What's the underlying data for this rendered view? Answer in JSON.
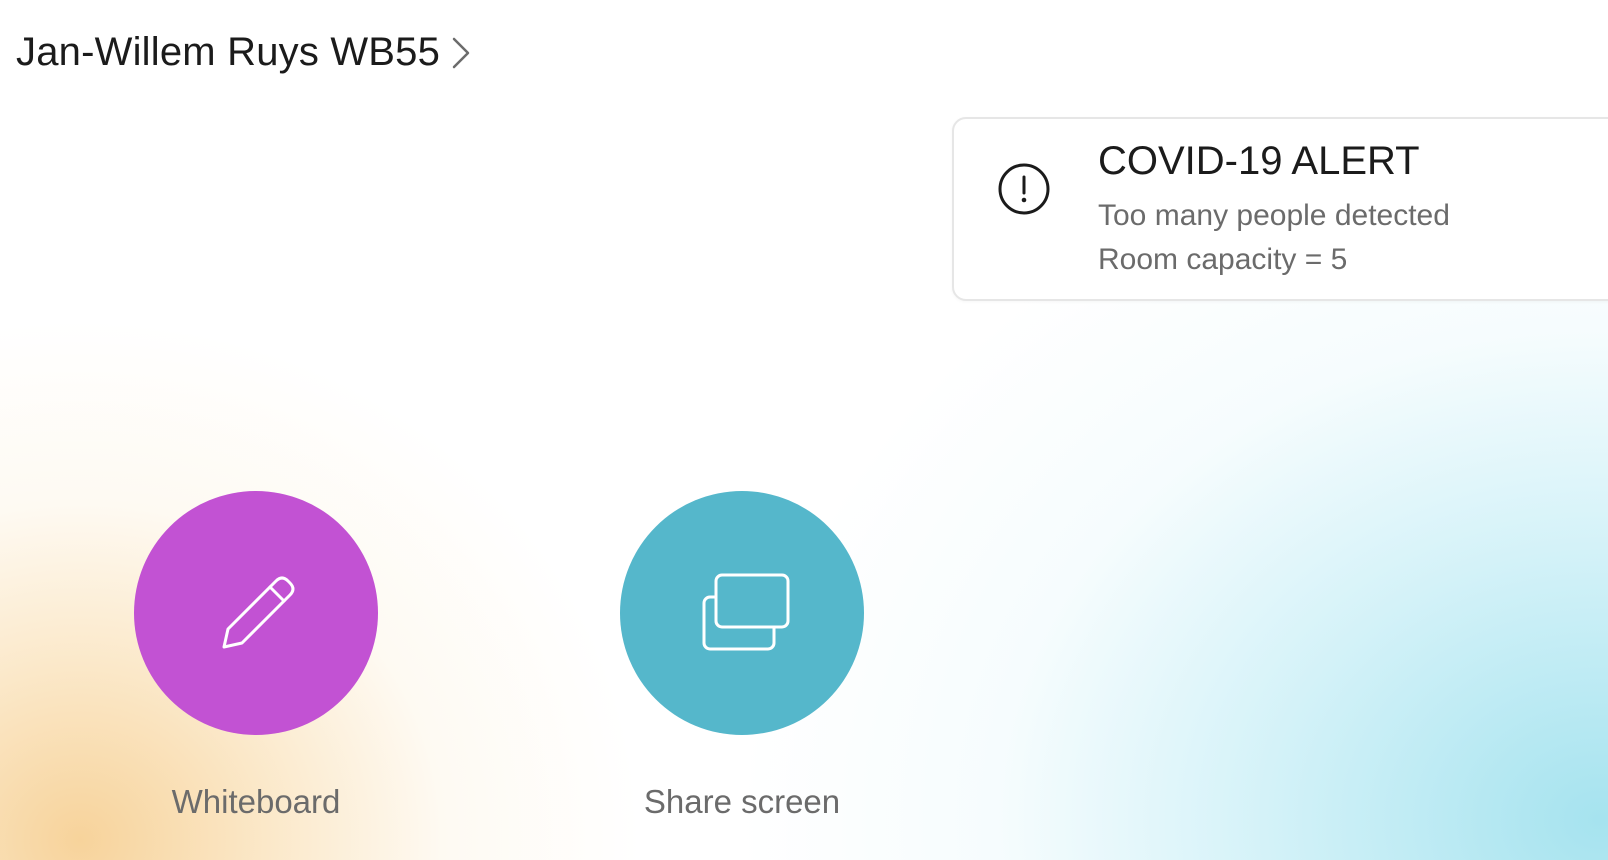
{
  "header": {
    "title": "Jan-Willem Ruys WB55",
    "chevron_icon": "chevron-right-icon"
  },
  "alert": {
    "icon": "exclamation-circle-icon",
    "title": "COVID-19 ALERT",
    "line1": "Too many people detected",
    "line2": "Room capacity = 5"
  },
  "actions": [
    {
      "label": "Whiteboard",
      "icon": "pencil-icon",
      "color": "#c252d3"
    },
    {
      "label": "Share screen",
      "icon": "share-screen-icon",
      "color": "#55b7cb"
    }
  ],
  "colors": {
    "background_warm": "#f6d29b",
    "background_cool": "#b8e9f3",
    "card_border": "#e6e6e6",
    "text_primary": "#1b1b1b",
    "text_secondary": "#6b6b6b"
  }
}
